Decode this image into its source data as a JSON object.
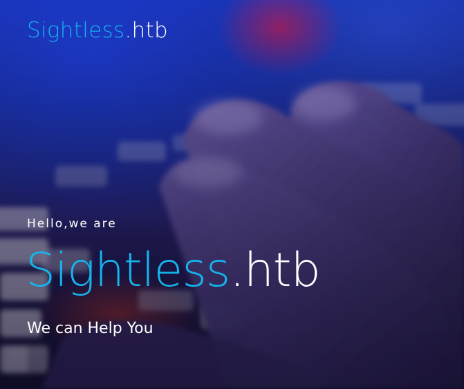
{
  "header": {
    "brand_name": "Sightless",
    "brand_suffix": ".htb"
  },
  "hero": {
    "greeting": "Hello,we are",
    "title_name": "Sightless",
    "title_suffix": ".htb",
    "tagline": "We can Help You"
  },
  "colors": {
    "accent": "#15b4ec",
    "text": "#ffffff"
  }
}
